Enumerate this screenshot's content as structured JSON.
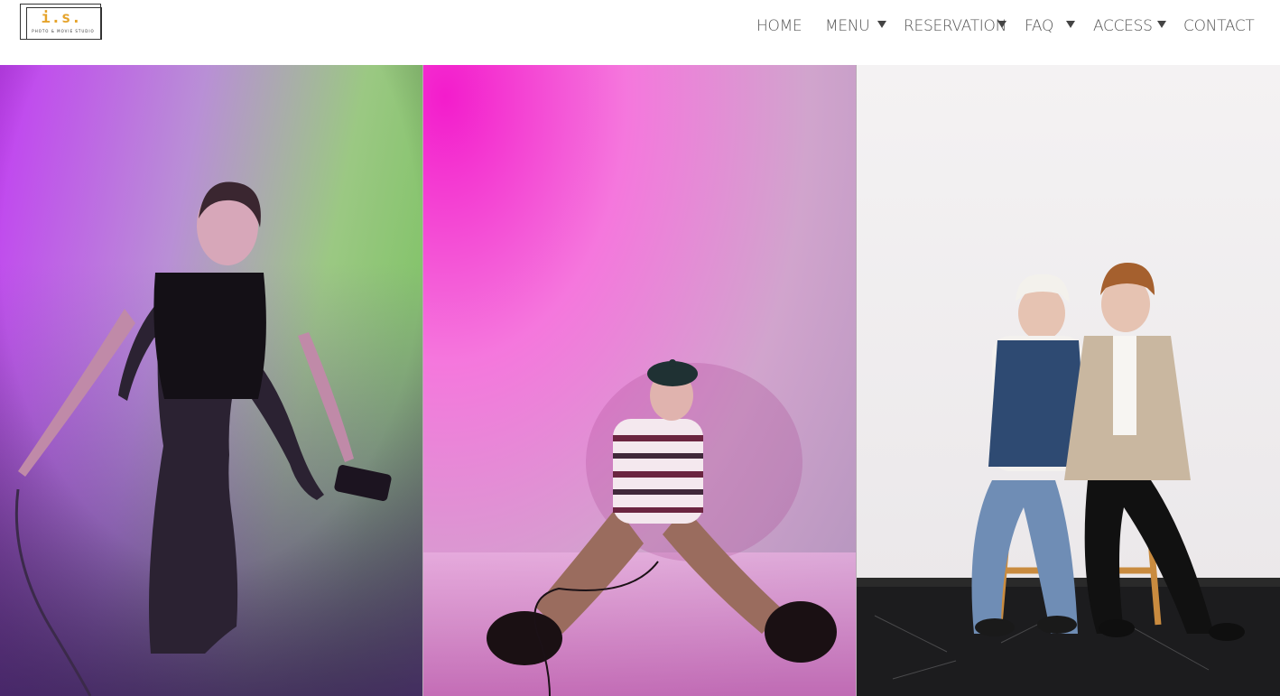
{
  "brand": {
    "logo_mark": "i.s.",
    "logo_tagline": "PHOTO & MOVIE STUDIO"
  },
  "nav": {
    "items": [
      {
        "label": "HOME",
        "has_dropdown": false
      },
      {
        "label": "MENU",
        "has_dropdown": true
      },
      {
        "label": "RESERVATION",
        "has_dropdown": true
      },
      {
        "label": "FAQ",
        "has_dropdown": true
      },
      {
        "label": "ACCESS",
        "has_dropdown": true
      },
      {
        "label": "CONTACT",
        "has_dropdown": false
      }
    ]
  },
  "hero": {
    "photos": [
      {
        "subject": "woman-with-cable-purple-green-backdrop",
        "palette": [
          "#c54bf0",
          "#8fd07b",
          "#5b3a86"
        ]
      },
      {
        "subject": "seated-person-pink-backdrop",
        "palette": [
          "#f24ad2",
          "#f9a0e3",
          "#a35e8e"
        ]
      },
      {
        "subject": "two-men-on-stools-white-backdrop",
        "palette": [
          "#f5f3f4",
          "#1a1a1a",
          "#c98b3f"
        ]
      }
    ]
  }
}
